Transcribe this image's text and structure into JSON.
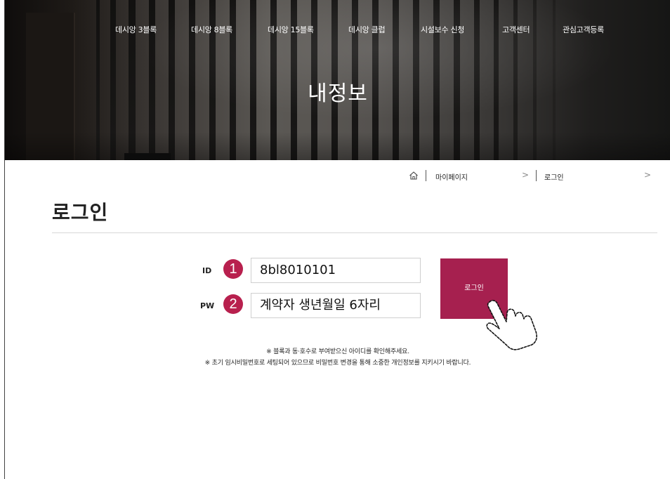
{
  "nav": {
    "items": [
      {
        "label": "데시앙 3블록"
      },
      {
        "label": "데시앙 8블록"
      },
      {
        "label": "데시앙 15블록"
      },
      {
        "label": "데시앙 클럽"
      },
      {
        "label": "시설보수 신청"
      },
      {
        "label": "고객센터"
      },
      {
        "label": "관심고객등록"
      }
    ]
  },
  "hero": {
    "title": "내정보"
  },
  "breadcrumb": {
    "home_icon": "home-icon",
    "level1": "마이페이지",
    "level2": "로그인",
    "chevron": ">"
  },
  "page": {
    "title": "로그인"
  },
  "form": {
    "id_label": "ID",
    "id_marker": "1",
    "id_value": "8bl8010101",
    "pw_label": "PW",
    "pw_marker": "2",
    "pw_value": "계약자 생년월일 6자리",
    "login_button": "로그인",
    "accent_color": "#a6204f"
  },
  "notes": {
    "line1": "※ 블록과 동·호수로 부여받으신 아이디를 확인해주세요.",
    "line2": "※ 초기 임시비밀번호로 세팅되어 있으므로 비밀번호 변경을 통해 소중한 개인정보를 지키시기 바랍니다."
  }
}
